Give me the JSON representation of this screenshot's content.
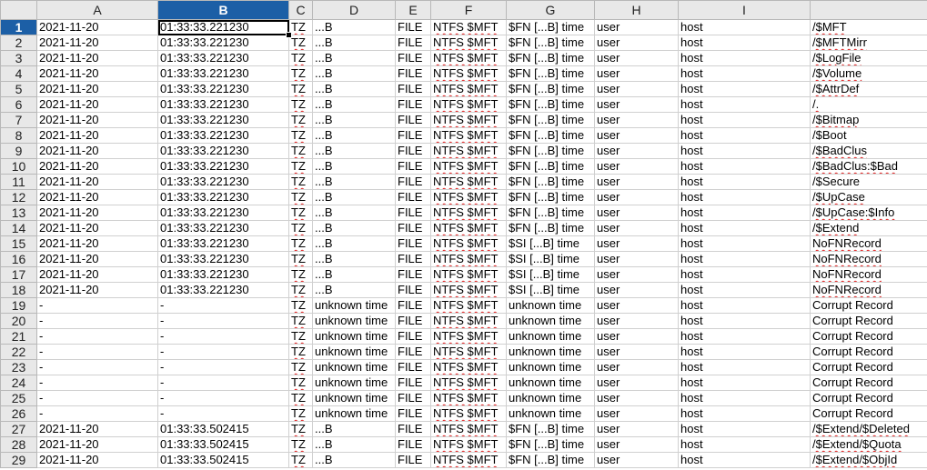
{
  "sheet": {
    "columns": [
      "A",
      "B",
      "C",
      "D",
      "E",
      "F",
      "G",
      "H",
      "I",
      ""
    ],
    "selected_column": "B",
    "selected_row": 1,
    "rows": [
      {
        "n": "1",
        "a": "2021-11-20",
        "b": "01:33:33.221230",
        "c": "TZ",
        "d": "...B",
        "e": "FILE",
        "f": "NTFS $MFT",
        "g": "$FN [...B] time",
        "h": "user",
        "i": "host",
        "j": "/$MFT"
      },
      {
        "n": "2",
        "a": "2021-11-20",
        "b": "01:33:33.221230",
        "c": "TZ",
        "d": "...B",
        "e": "FILE",
        "f": "NTFS $MFT",
        "g": "$FN [...B] time",
        "h": "user",
        "i": "host",
        "j": "/$MFTMirr"
      },
      {
        "n": "3",
        "a": "2021-11-20",
        "b": "01:33:33.221230",
        "c": "TZ",
        "d": "...B",
        "e": "FILE",
        "f": "NTFS $MFT",
        "g": "$FN [...B] time",
        "h": "user",
        "i": "host",
        "j": "/$LogFile"
      },
      {
        "n": "4",
        "a": "2021-11-20",
        "b": "01:33:33.221230",
        "c": "TZ",
        "d": "...B",
        "e": "FILE",
        "f": "NTFS $MFT",
        "g": "$FN [...B] time",
        "h": "user",
        "i": "host",
        "j": "/$Volume"
      },
      {
        "n": "5",
        "a": "2021-11-20",
        "b": "01:33:33.221230",
        "c": "TZ",
        "d": "...B",
        "e": "FILE",
        "f": "NTFS $MFT",
        "g": "$FN [...B] time",
        "h": "user",
        "i": "host",
        "j": "/$AttrDef"
      },
      {
        "n": "6",
        "a": "2021-11-20",
        "b": "01:33:33.221230",
        "c": "TZ",
        "d": "...B",
        "e": "FILE",
        "f": "NTFS $MFT",
        "g": "$FN [...B] time",
        "h": "user",
        "i": "host",
        "j": "/."
      },
      {
        "n": "7",
        "a": "2021-11-20",
        "b": "01:33:33.221230",
        "c": "TZ",
        "d": "...B",
        "e": "FILE",
        "f": "NTFS $MFT",
        "g": "$FN [...B] time",
        "h": "user",
        "i": "host",
        "j": "/$Bitmap"
      },
      {
        "n": "8",
        "a": "2021-11-20",
        "b": "01:33:33.221230",
        "c": "TZ",
        "d": "...B",
        "e": "FILE",
        "f": "NTFS $MFT",
        "g": "$FN [...B] time",
        "h": "user",
        "i": "host",
        "j": "/$Boot"
      },
      {
        "n": "9",
        "a": "2021-11-20",
        "b": "01:33:33.221230",
        "c": "TZ",
        "d": "...B",
        "e": "FILE",
        "f": "NTFS $MFT",
        "g": "$FN [...B] time",
        "h": "user",
        "i": "host",
        "j": "/$BadClus"
      },
      {
        "n": "10",
        "a": "2021-11-20",
        "b": "01:33:33.221230",
        "c": "TZ",
        "d": "...B",
        "e": "FILE",
        "f": "NTFS $MFT",
        "g": "$FN [...B] time",
        "h": "user",
        "i": "host",
        "j": "/$BadClus:$Bad"
      },
      {
        "n": "11",
        "a": "2021-11-20",
        "b": "01:33:33.221230",
        "c": "TZ",
        "d": "...B",
        "e": "FILE",
        "f": "NTFS $MFT",
        "g": "$FN [...B] time",
        "h": "user",
        "i": "host",
        "j": "/$Secure"
      },
      {
        "n": "12",
        "a": "2021-11-20",
        "b": "01:33:33.221230",
        "c": "TZ",
        "d": "...B",
        "e": "FILE",
        "f": "NTFS $MFT",
        "g": "$FN [...B] time",
        "h": "user",
        "i": "host",
        "j": "/$UpCase"
      },
      {
        "n": "13",
        "a": "2021-11-20",
        "b": "01:33:33.221230",
        "c": "TZ",
        "d": "...B",
        "e": "FILE",
        "f": "NTFS $MFT",
        "g": "$FN [...B] time",
        "h": "user",
        "i": "host",
        "j": "/$UpCase:$Info"
      },
      {
        "n": "14",
        "a": "2021-11-20",
        "b": "01:33:33.221230",
        "c": "TZ",
        "d": "...B",
        "e": "FILE",
        "f": "NTFS $MFT",
        "g": "$FN [...B] time",
        "h": "user",
        "i": "host",
        "j": "/$Extend"
      },
      {
        "n": "15",
        "a": "2021-11-20",
        "b": "01:33:33.221230",
        "c": "TZ",
        "d": "...B",
        "e": "FILE",
        "f": "NTFS $MFT",
        "g": "$SI [...B] time",
        "h": "user",
        "i": "host",
        "j": "NoFNRecord"
      },
      {
        "n": "16",
        "a": "2021-11-20",
        "b": "01:33:33.221230",
        "c": "TZ",
        "d": "...B",
        "e": "FILE",
        "f": "NTFS $MFT",
        "g": "$SI [...B] time",
        "h": "user",
        "i": "host",
        "j": "NoFNRecord"
      },
      {
        "n": "17",
        "a": "2021-11-20",
        "b": "01:33:33.221230",
        "c": "TZ",
        "d": "...B",
        "e": "FILE",
        "f": "NTFS $MFT",
        "g": "$SI [...B] time",
        "h": "user",
        "i": "host",
        "j": "NoFNRecord"
      },
      {
        "n": "18",
        "a": "2021-11-20",
        "b": "01:33:33.221230",
        "c": "TZ",
        "d": "...B",
        "e": "FILE",
        "f": "NTFS $MFT",
        "g": "$SI [...B] time",
        "h": "user",
        "i": "host",
        "j": "NoFNRecord"
      },
      {
        "n": "19",
        "a": "-",
        "b": "-",
        "c": "TZ",
        "d": "unknown time",
        "e": "FILE",
        "f": "NTFS $MFT",
        "g": "unknown time",
        "h": "user",
        "i": "host",
        "j": "Corrupt Record"
      },
      {
        "n": "20",
        "a": "-",
        "b": "-",
        "c": "TZ",
        "d": "unknown time",
        "e": "FILE",
        "f": "NTFS $MFT",
        "g": "unknown time",
        "h": "user",
        "i": "host",
        "j": "Corrupt Record"
      },
      {
        "n": "21",
        "a": "-",
        "b": "-",
        "c": "TZ",
        "d": "unknown time",
        "e": "FILE",
        "f": "NTFS $MFT",
        "g": "unknown time",
        "h": "user",
        "i": "host",
        "j": "Corrupt Record"
      },
      {
        "n": "22",
        "a": "-",
        "b": "-",
        "c": "TZ",
        "d": "unknown time",
        "e": "FILE",
        "f": "NTFS $MFT",
        "g": "unknown time",
        "h": "user",
        "i": "host",
        "j": "Corrupt Record"
      },
      {
        "n": "23",
        "a": "-",
        "b": "-",
        "c": "TZ",
        "d": "unknown time",
        "e": "FILE",
        "f": "NTFS $MFT",
        "g": "unknown time",
        "h": "user",
        "i": "host",
        "j": "Corrupt Record"
      },
      {
        "n": "24",
        "a": "-",
        "b": "-",
        "c": "TZ",
        "d": "unknown time",
        "e": "FILE",
        "f": "NTFS $MFT",
        "g": "unknown time",
        "h": "user",
        "i": "host",
        "j": "Corrupt Record"
      },
      {
        "n": "25",
        "a": "-",
        "b": "-",
        "c": "TZ",
        "d": "unknown time",
        "e": "FILE",
        "f": "NTFS $MFT",
        "g": "unknown time",
        "h": "user",
        "i": "host",
        "j": "Corrupt Record"
      },
      {
        "n": "26",
        "a": "-",
        "b": "-",
        "c": "TZ",
        "d": "unknown time",
        "e": "FILE",
        "f": "NTFS $MFT",
        "g": "unknown time",
        "h": "user",
        "i": "host",
        "j": "Corrupt Record"
      },
      {
        "n": "27",
        "a": "2021-11-20",
        "b": "01:33:33.502415",
        "c": "TZ",
        "d": "...B",
        "e": "FILE",
        "f": "NTFS $MFT",
        "g": "$FN [...B] time",
        "h": "user",
        "i": "host",
        "j": "/$Extend/$Deleted"
      },
      {
        "n": "28",
        "a": "2021-11-20",
        "b": "01:33:33.502415",
        "c": "TZ",
        "d": "...B",
        "e": "FILE",
        "f": "NTFS $MFT",
        "g": "$FN [...B] time",
        "h": "user",
        "i": "host",
        "j": "/$Extend/$Quota"
      },
      {
        "n": "29",
        "a": "2021-11-20",
        "b": "01:33:33.502415",
        "c": "TZ",
        "d": "...B",
        "e": "FILE",
        "f": "NTFS $MFT",
        "g": "$FN [...B] time",
        "h": "user",
        "i": "host",
        "j": "/$Extend/$ObjId"
      }
    ]
  }
}
